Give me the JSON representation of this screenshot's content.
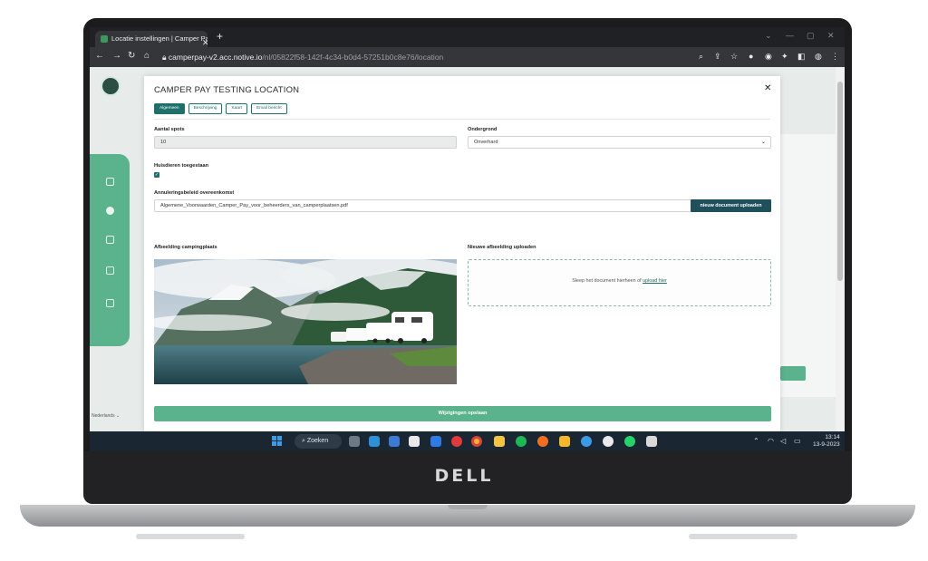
{
  "browser": {
    "tab_title": "Locatie instellingen | Camper Pay",
    "url_domain": "camperpay-v2.acc.notive.io",
    "url_path": "/nl/05822f58-142f-4c34-b0d4-57251b0c8e76/location"
  },
  "modal": {
    "title": "CAMPER PAY TESTING LOCATION",
    "tabs": [
      {
        "label": "Algemeen",
        "active": true
      },
      {
        "label": "Beschrijving",
        "active": false
      },
      {
        "label": "Kaart",
        "active": false
      },
      {
        "label": "Email bericht",
        "active": false
      }
    ],
    "spots_label": "Aantal spots",
    "spots_value": "10",
    "ground_label": "Ondergrond",
    "ground_value": "Onverhard",
    "pets_label": "Huisdieren toegestaan",
    "pets_checked": true,
    "policy_label": "Annuleringsbeleid overeenkomst",
    "policy_file": "Algemene_Voorwaarden_Camper_Pay_voor_beheerders_van_camperplaatsen.pdf",
    "policy_upload_button": "nieuw document uploaden",
    "image_label": "Afbeelding campingplaats",
    "new_image_label": "Nieuwe afbeelding uploaden",
    "dropzone_text": "Sleep het document hierheen of",
    "dropzone_link": "upload hier",
    "save_button": "Wijzigingen opslaan"
  },
  "sidebar": {
    "language": "Nederlands"
  },
  "taskbar": {
    "search_label": "Zoeken",
    "time": "13:14",
    "date": "13-9-2023"
  },
  "device": {
    "brand": "DELL"
  },
  "colors": {
    "primary": "#1f6f6a",
    "accent_green": "#5ab38c",
    "upload_button": "#1f4f5a"
  }
}
